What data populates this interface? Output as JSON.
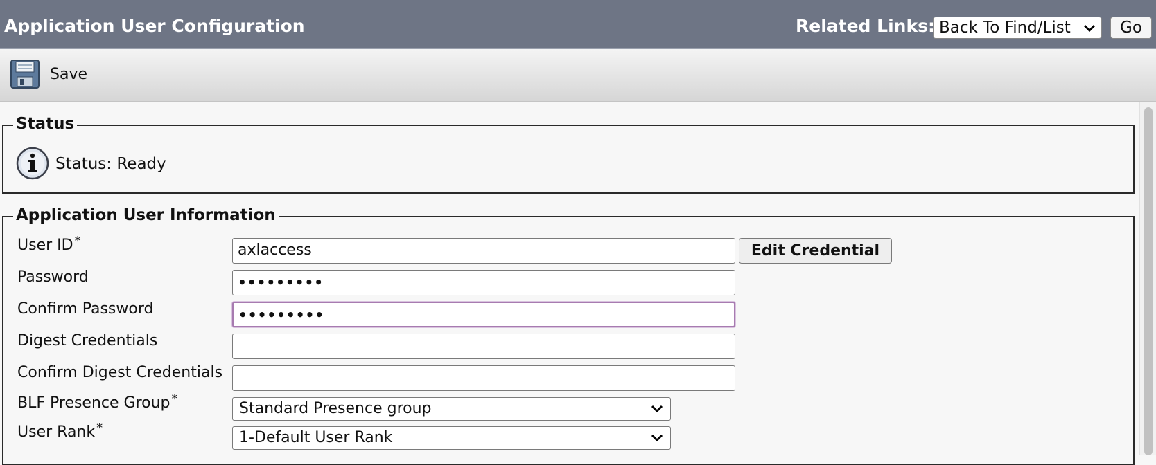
{
  "header": {
    "title": "Application User Configuration",
    "related_links_label": "Related Links:",
    "related_links_selected": "Back To Find/List",
    "go_label": "Go"
  },
  "toolbar": {
    "save_label": "Save",
    "save_icon": "floppy-disk-icon"
  },
  "status": {
    "legend": "Status",
    "text": "Status: Ready",
    "icon": "info-icon"
  },
  "user_info": {
    "legend": "Application User Information",
    "required_marker": "*",
    "fields": {
      "user_id": {
        "label": "User ID",
        "value": "axlaccess",
        "required": true
      },
      "password": {
        "label": "Password",
        "value": "•••••••••"
      },
      "confirm_password": {
        "label": "Confirm Password",
        "value": "•••••••••",
        "focused": true
      },
      "digest": {
        "label": "Digest Credentials",
        "value": ""
      },
      "confirm_digest": {
        "label": "Confirm Digest Credentials",
        "value": ""
      },
      "blf": {
        "label": "BLF Presence Group",
        "value": "Standard Presence group",
        "required": true
      },
      "rank": {
        "label": "User Rank",
        "value": "1-Default User Rank",
        "required": true
      }
    },
    "edit_credential_label": "Edit Credential"
  },
  "colors": {
    "title_bar": "#6e7585",
    "focus_border": "#a77bb0",
    "background": "#f7f7f7"
  }
}
